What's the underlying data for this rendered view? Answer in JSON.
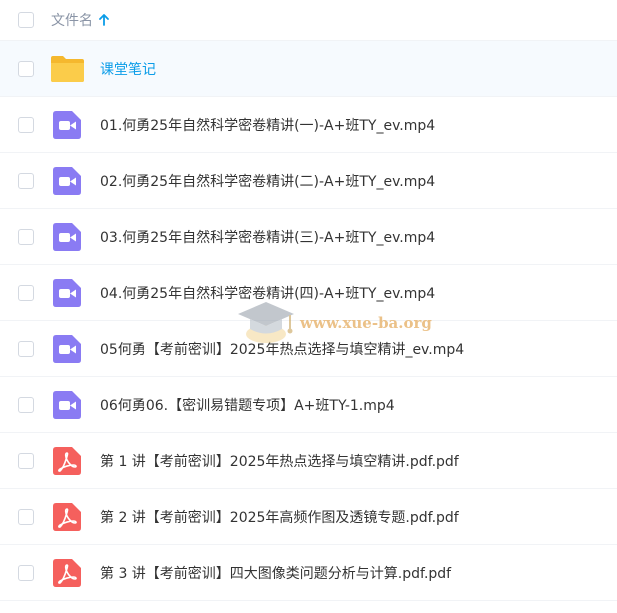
{
  "header": {
    "name_column_label": "文件名",
    "sort_direction": "ascending"
  },
  "colors": {
    "folder_name": "#0a9ce8",
    "video_icon": "#8a7bf3",
    "pdf_icon": "#f5605d",
    "folder_icon": "#fbcc4a"
  },
  "rows": [
    {
      "type": "folder",
      "icon": "folder-icon",
      "name": "课堂笔记"
    },
    {
      "type": "video",
      "icon": "video-file-icon",
      "name": "01.何勇25年自然科学密卷精讲(一)-A+班TY_ev.mp4"
    },
    {
      "type": "video",
      "icon": "video-file-icon",
      "name": "02.何勇25年自然科学密卷精讲(二)-A+班TY_ev.mp4"
    },
    {
      "type": "video",
      "icon": "video-file-icon",
      "name": "03.何勇25年自然科学密卷精讲(三)-A+班TY_ev.mp4"
    },
    {
      "type": "video",
      "icon": "video-file-icon",
      "name": "04.何勇25年自然科学密卷精讲(四)-A+班TY_ev.mp4"
    },
    {
      "type": "video",
      "icon": "video-file-icon",
      "name": "05何勇【考前密训】2025年热点选择与填空精讲_ev.mp4"
    },
    {
      "type": "video",
      "icon": "video-file-icon",
      "name": "06何勇06.【密训易错题专项】A+班TY-1.mp4"
    },
    {
      "type": "pdf",
      "icon": "pdf-file-icon",
      "name": "第 1 讲【考前密训】2025年热点选择与填空精讲.pdf.pdf"
    },
    {
      "type": "pdf",
      "icon": "pdf-file-icon",
      "name": "第 2 讲【考前密训】2025年高频作图及透镜专题.pdf.pdf"
    },
    {
      "type": "pdf",
      "icon": "pdf-file-icon",
      "name": "第 3 讲【考前密训】四大图像类问题分析与计算.pdf.pdf"
    }
  ],
  "watermark": {
    "text": "www.xue-ba.org",
    "icon": "graduation-cap-icon"
  }
}
